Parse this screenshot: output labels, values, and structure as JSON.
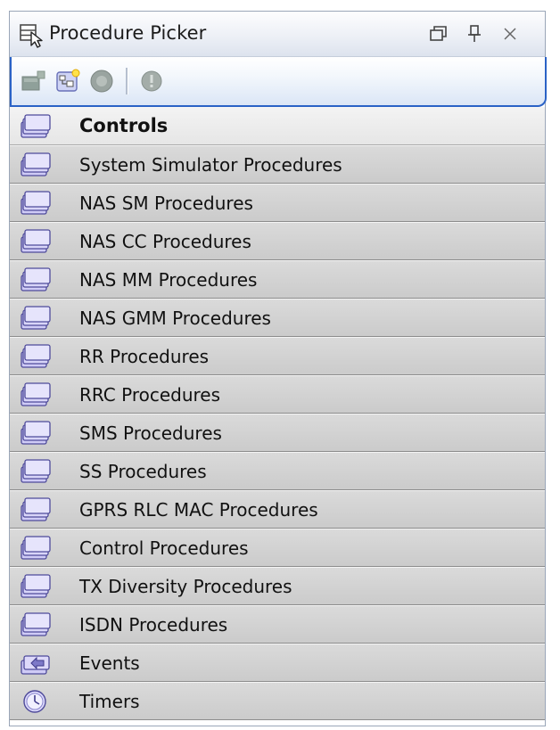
{
  "panel": {
    "title": "Procedure Picker",
    "title_icon": "procedure-picker-icon",
    "controls": {
      "restore_icon": "window-restore-icon",
      "pin_icon": "pin-icon",
      "close_icon": "close-icon"
    }
  },
  "toolbar": {
    "tools": [
      {
        "icon": "add-procedure-icon",
        "enabled": false
      },
      {
        "icon": "new-sequence-icon",
        "enabled": true
      },
      {
        "icon": "record-icon",
        "enabled": false
      },
      {
        "icon": "properties-icon",
        "enabled": false
      }
    ]
  },
  "list": {
    "items": [
      {
        "label": "Controls",
        "icon": "folder-stack-icon",
        "selected": true
      },
      {
        "label": "System Simulator Procedures",
        "icon": "folder-stack-icon",
        "selected": false
      },
      {
        "label": "NAS SM Procedures",
        "icon": "folder-stack-icon",
        "selected": false
      },
      {
        "label": "NAS CC Procedures",
        "icon": "folder-stack-icon",
        "selected": false
      },
      {
        "label": "NAS MM Procedures",
        "icon": "folder-stack-icon",
        "selected": false
      },
      {
        "label": "NAS GMM Procedures",
        "icon": "folder-stack-icon",
        "selected": false
      },
      {
        "label": "RR Procedures",
        "icon": "folder-stack-icon",
        "selected": false
      },
      {
        "label": "RRC Procedures",
        "icon": "folder-stack-icon",
        "selected": false
      },
      {
        "label": "SMS Procedures",
        "icon": "folder-stack-icon",
        "selected": false
      },
      {
        "label": "SS Procedures",
        "icon": "folder-stack-icon",
        "selected": false
      },
      {
        "label": "GPRS RLC MAC Procedures",
        "icon": "folder-stack-icon",
        "selected": false
      },
      {
        "label": "Control Procedures",
        "icon": "folder-stack-icon",
        "selected": false
      },
      {
        "label": "TX Diversity Procedures",
        "icon": "folder-stack-icon",
        "selected": false
      },
      {
        "label": "ISDN Procedures",
        "icon": "folder-stack-icon",
        "selected": false
      },
      {
        "label": "Events",
        "icon": "events-icon",
        "selected": false
      },
      {
        "label": "Timers",
        "icon": "timers-icon",
        "selected": false
      }
    ]
  },
  "colors": {
    "accent_border": "#2a62c6",
    "row_bg": "#d3d3d3",
    "row_selected_bg": "#ececec",
    "icon_lavender": "#c9c6f2"
  }
}
